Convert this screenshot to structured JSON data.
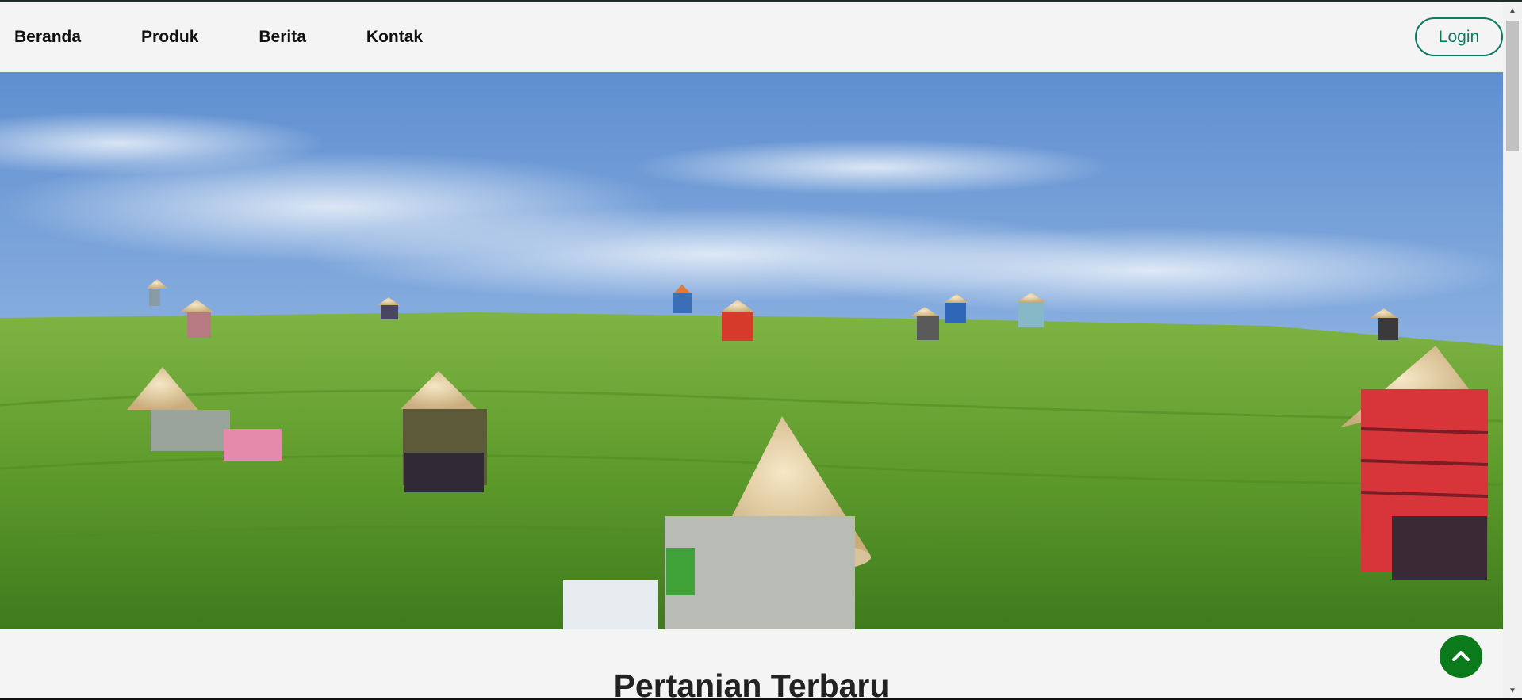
{
  "nav": {
    "links": [
      {
        "label": "Beranda"
      },
      {
        "label": "Produk"
      },
      {
        "label": "Berita"
      },
      {
        "label": "Kontak"
      }
    ],
    "login_label": "Login"
  },
  "hero": {
    "image_icon": "tea-plantation-photo"
  },
  "section": {
    "title": "Pertanian Terbaru"
  },
  "back_to_top": {
    "icon": "chevron-up-icon"
  },
  "scrollbar": {
    "up_icon": "scroll-up-arrow",
    "down_icon": "scroll-down-arrow"
  },
  "colors": {
    "accent": "#0f7a62",
    "to_top": "#0b7a1a",
    "background": "#f4f4f4",
    "sky_top": "#6f9bd6",
    "field": "#5e9b2c"
  }
}
